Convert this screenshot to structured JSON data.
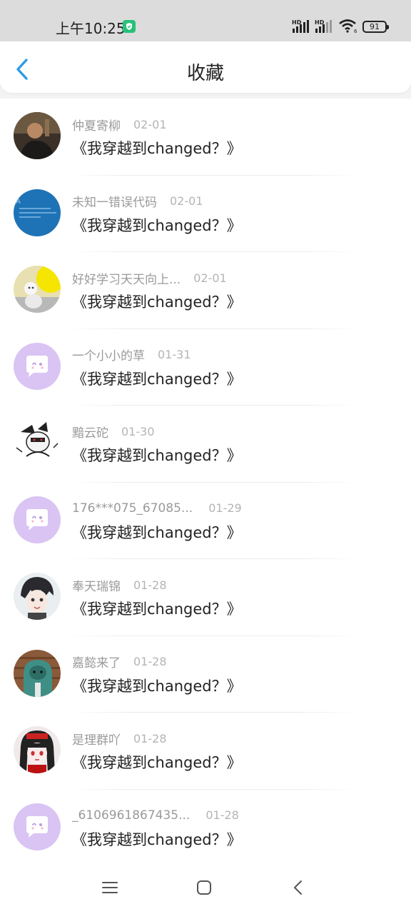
{
  "status_bar": {
    "time": "上午10:25",
    "signal_label_1": "HD",
    "signal_label_2": "HD",
    "battery": "91"
  },
  "header": {
    "title": "收藏"
  },
  "items": [
    {
      "user": "仲夏寄柳",
      "date": "02-01",
      "title": "《我穿越到changed？》",
      "avatar": "photo-man-avatar"
    },
    {
      "user": "未知一错误代码",
      "date": "02-01",
      "title": "《我穿越到changed？》",
      "avatar": "blue-screen-avatar"
    },
    {
      "user": "好好学习天天向上...",
      "date": "02-01",
      "title": "《我穿越到changed？》",
      "avatar": "yellow-cartoon-avatar"
    },
    {
      "user": "一个小小的草",
      "date": "01-31",
      "title": "《我穿越到changed？》",
      "avatar": "default-chat-avatar"
    },
    {
      "user": "黯云砣",
      "date": "01-30",
      "title": "《我穿越到changed？》",
      "avatar": "sketch-character-avatar"
    },
    {
      "user": "176***075_67085...",
      "date": "01-29",
      "title": "《我穿越到changed？》",
      "avatar": "default-chat-avatar"
    },
    {
      "user": "奉天瑞锦",
      "date": "01-28",
      "title": "《我穿越到changed？》",
      "avatar": "anime-boy-avatar"
    },
    {
      "user": "嘉懿来了",
      "date": "01-28",
      "title": "《我穿越到changed？》",
      "avatar": "green-hood-avatar"
    },
    {
      "user": "是理群吖",
      "date": "01-28",
      "title": "《我穿越到changed？》",
      "avatar": "anime-girl-avatar"
    },
    {
      "user": "_6106961867435...",
      "date": "01-28",
      "title": "《我穿越到changed？》",
      "avatar": "default-chat-avatar"
    }
  ],
  "colors": {
    "accent": "#2e9be6",
    "default_avatar": "#d9c4f3"
  }
}
